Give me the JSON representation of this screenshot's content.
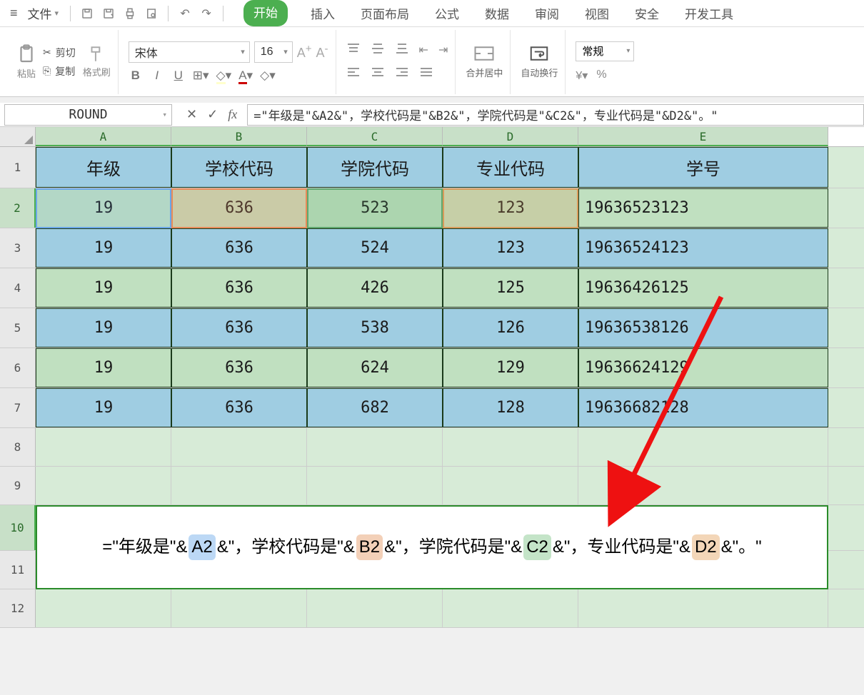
{
  "menu": {
    "file": "文件",
    "tabs": [
      "开始",
      "插入",
      "页面布局",
      "公式",
      "数据",
      "审阅",
      "视图",
      "安全",
      "开发工具"
    ],
    "active_tab_index": 0
  },
  "ribbon": {
    "paste": "粘贴",
    "cut": "剪切",
    "copy": "复制",
    "format_painter": "格式刷",
    "font_name": "宋体",
    "font_size": "16",
    "merge": "合并居中",
    "wrap": "自动换行",
    "number_format": "常规"
  },
  "namebox": "ROUND",
  "formula_bar": "=\"年级是\"&A2&\"，学校代码是\"&B2&\"，学院代码是\"&C2&\"，专业代码是\"&D2&\"。\"",
  "columns": [
    "A",
    "B",
    "C",
    "D",
    "E"
  ],
  "header_row": [
    "年级",
    "学校代码",
    "学院代码",
    "专业代码",
    "学号"
  ],
  "data_rows": [
    [
      "19",
      "636",
      "523",
      "123",
      "19636523123"
    ],
    [
      "19",
      "636",
      "524",
      "123",
      "19636524123"
    ],
    [
      "19",
      "636",
      "426",
      "125",
      "19636426125"
    ],
    [
      "19",
      "636",
      "538",
      "126",
      "19636538126"
    ],
    [
      "19",
      "636",
      "624",
      "129",
      "19636624129"
    ],
    [
      "19",
      "636",
      "682",
      "128",
      "19636682128"
    ]
  ],
  "editing_formula": {
    "parts": [
      {
        "t": "=\"年级是\"&",
        "c": null
      },
      {
        "t": "A2",
        "c": "a2"
      },
      {
        "t": "&\"，学校代码是\"&",
        "c": null
      },
      {
        "t": "B2",
        "c": "b2"
      },
      {
        "t": "&\"，学院代码是\"&",
        "c": null
      },
      {
        "t": "C2",
        "c": "c2"
      },
      {
        "t": "&\"，专业代码是\"&",
        "c": null
      },
      {
        "t": "D2",
        "c": "d2"
      },
      {
        "t": "&\"。\"",
        "c": null
      }
    ]
  }
}
